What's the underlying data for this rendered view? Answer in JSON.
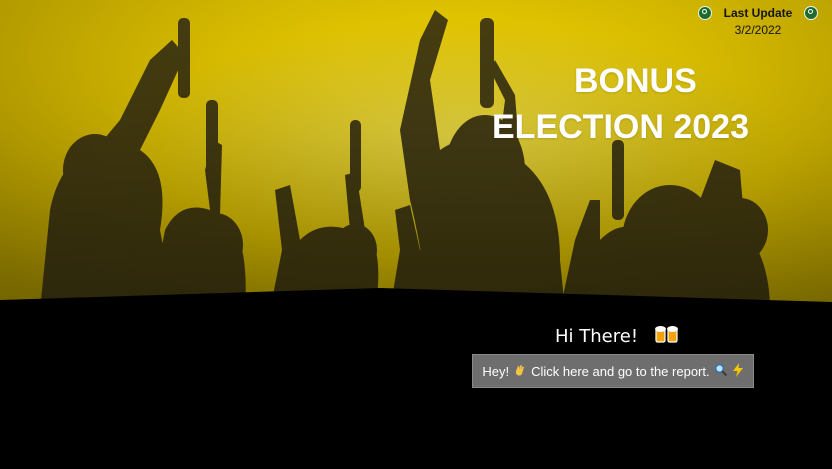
{
  "update": {
    "label": "Last Update",
    "date": "3/2/2022",
    "icon_left": "refresh-icon",
    "icon_right": "refresh-icon"
  },
  "title": {
    "line1": "BONUS",
    "line2": "ELECTION 2023"
  },
  "greeting": {
    "text": "Hi There!",
    "icon": "beer-mugs-icon"
  },
  "cta": {
    "prefix": "Hey!",
    "label": "Click here and go to the report.",
    "icons": [
      "waving-hand-icon",
      "magnifier-icon",
      "lightning-icon"
    ]
  },
  "colors": {
    "hero_yellow": "#e6c800",
    "hero_dark": "#2a2410",
    "background": "#000000",
    "button_bg": "#6e6e6e",
    "update_icon": "#1f6b2e"
  }
}
